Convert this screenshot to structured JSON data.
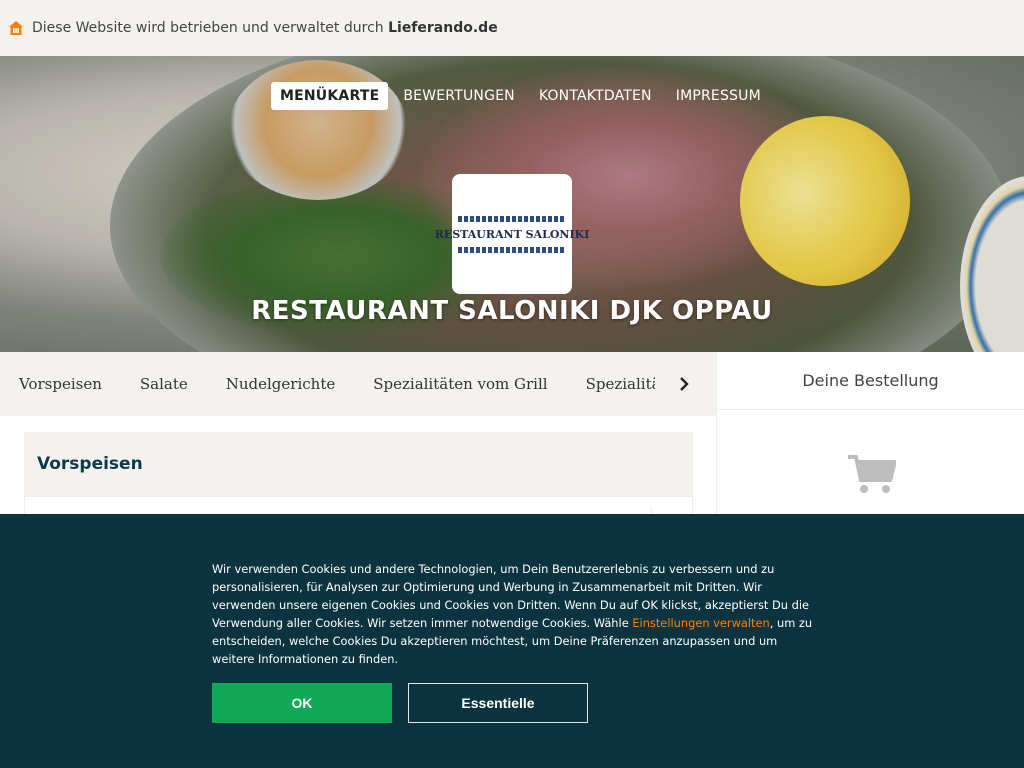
{
  "topbar": {
    "prefix": "Diese Website wird betrieben und verwaltet durch ",
    "brand": "Lieferando.de",
    "logo_icon": "lieferando-house-icon",
    "logo_color": "#ff8000"
  },
  "nav": {
    "items": [
      {
        "label": "MENÜKARTE",
        "active": true
      },
      {
        "label": "BEWERTUNGEN",
        "active": false
      },
      {
        "label": "KONTAKTDATEN",
        "active": false
      },
      {
        "label": "IMPRESSUM",
        "active": false
      }
    ]
  },
  "restaurant": {
    "logo_text": "RESTAURANT SALONIKI",
    "name": "RESTAURANT SALONIKI DJK OPPAU"
  },
  "categories": {
    "items": [
      "Vorspeisen",
      "Salate",
      "Nudelgerichte",
      "Spezialitäten vom Grill",
      "Spezialitäten vom Pfännchen"
    ],
    "next_icon": "chevron-right-icon"
  },
  "section": {
    "title": "Vorspeisen"
  },
  "order": {
    "title": "Deine Bestellung",
    "cart_icon": "shopping-cart-icon"
  },
  "cookie": {
    "text_before": "Wir verwenden Cookies und andere Technologien, um Dein Benutzererlebnis zu verbessern und zu personalisieren, für Analysen zur Optimierung und Werbung in Zusammenarbeit mit Dritten. Wir verwenden unsere eigenen Cookies und Cookies von Dritten. Wenn Du auf OK klickst, akzeptierst Du die Verwendung aller Cookies. Wir setzen immer notwendige Cookies. Wähle ",
    "link": "Einstellungen verwalten",
    "text_after": ", um zu entscheiden, welche Cookies Du akzeptieren möchtest, um Deine Präferenzen anzupassen und um weitere Informationen zu finden.",
    "ok_label": "OK",
    "essential_label": "Essentielle",
    "ok_color": "#0fa958",
    "link_color": "#ff8000",
    "background": "#0b3440"
  }
}
